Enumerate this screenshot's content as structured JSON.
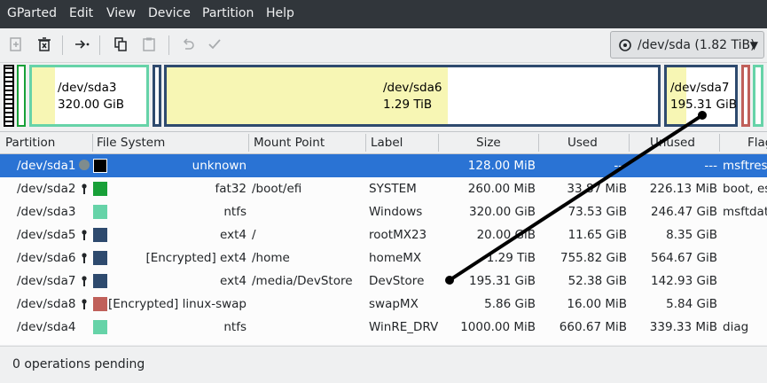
{
  "menu": [
    "GParted",
    "Edit",
    "View",
    "Device",
    "Partition",
    "Help"
  ],
  "toolbar": {
    "icons": [
      "new-icon",
      "delete-icon",
      "resize-move-icon",
      "copy-icon",
      "paste-icon",
      "undo-icon",
      "apply-icon"
    ],
    "device": "/dev/sda (1.82 TiB)"
  },
  "map": {
    "sda3": {
      "name": "/dev/sda3",
      "size": "320.00 GiB"
    },
    "sda6": {
      "name": "/dev/sda6",
      "size": "1.29 TiB"
    },
    "sda7": {
      "name": "/dev/sda7",
      "size": "195.31 GiB"
    }
  },
  "columns": [
    "Partition",
    "File System",
    "Mount Point",
    "Label",
    "Size",
    "Used",
    "Unused",
    "Flags"
  ],
  "rows": [
    {
      "partition": "/dev/sda1",
      "fs": "unknown",
      "mount": "",
      "label": "",
      "size": "128.00 MiB",
      "used": "---",
      "unused": "---",
      "flags": "msftres",
      "color": "#000000",
      "icon": "warning"
    },
    {
      "partition": "/dev/sda2",
      "fs": "fat32",
      "mount": "/boot/efi",
      "label": "SYSTEM",
      "size": "260.00 MiB",
      "used": "33.87 MiB",
      "unused": "226.13 MiB",
      "flags": "boot, esp",
      "color": "#18a038",
      "icon": "key"
    },
    {
      "partition": "/dev/sda3",
      "fs": "ntfs",
      "mount": "",
      "label": "Windows",
      "size": "320.00 GiB",
      "used": "73.53 GiB",
      "unused": "246.47 GiB",
      "flags": "msftdata",
      "color": "#66d3a8",
      "icon": ""
    },
    {
      "partition": "/dev/sda5",
      "fs": "ext4",
      "mount": "/",
      "label": "rootMX23",
      "size": "20.00 GiB",
      "used": "11.65 GiB",
      "unused": "8.35 GiB",
      "flags": "",
      "color": "#2e4a6e",
      "icon": "key"
    },
    {
      "partition": "/dev/sda6",
      "fs": "[Encrypted] ext4",
      "mount": "/home",
      "label": "homeMX",
      "size": "1.29 TiB",
      "used": "755.82 GiB",
      "unused": "564.67 GiB",
      "flags": "",
      "color": "#2e4a6e",
      "icon": "key"
    },
    {
      "partition": "/dev/sda7",
      "fs": "ext4",
      "mount": "/media/DevStore",
      "label": "DevStore",
      "size": "195.31 GiB",
      "used": "52.38 GiB",
      "unused": "142.93 GiB",
      "flags": "",
      "color": "#2e4a6e",
      "icon": "key"
    },
    {
      "partition": "/dev/sda8",
      "fs": "[Encrypted] linux-swap",
      "mount": "",
      "label": "swapMX",
      "size": "5.86 GiB",
      "used": "16.00 MiB",
      "unused": "5.84 GiB",
      "flags": "",
      "color": "#c0605a",
      "icon": "key"
    },
    {
      "partition": "/dev/sda4",
      "fs": "ntfs",
      "mount": "",
      "label": "WinRE_DRV",
      "size": "1000.00 MiB",
      "used": "660.67 MiB",
      "unused": "339.33 MiB",
      "flags": "diag",
      "color": "#66d3a8",
      "icon": ""
    }
  ],
  "status": "0 operations pending"
}
